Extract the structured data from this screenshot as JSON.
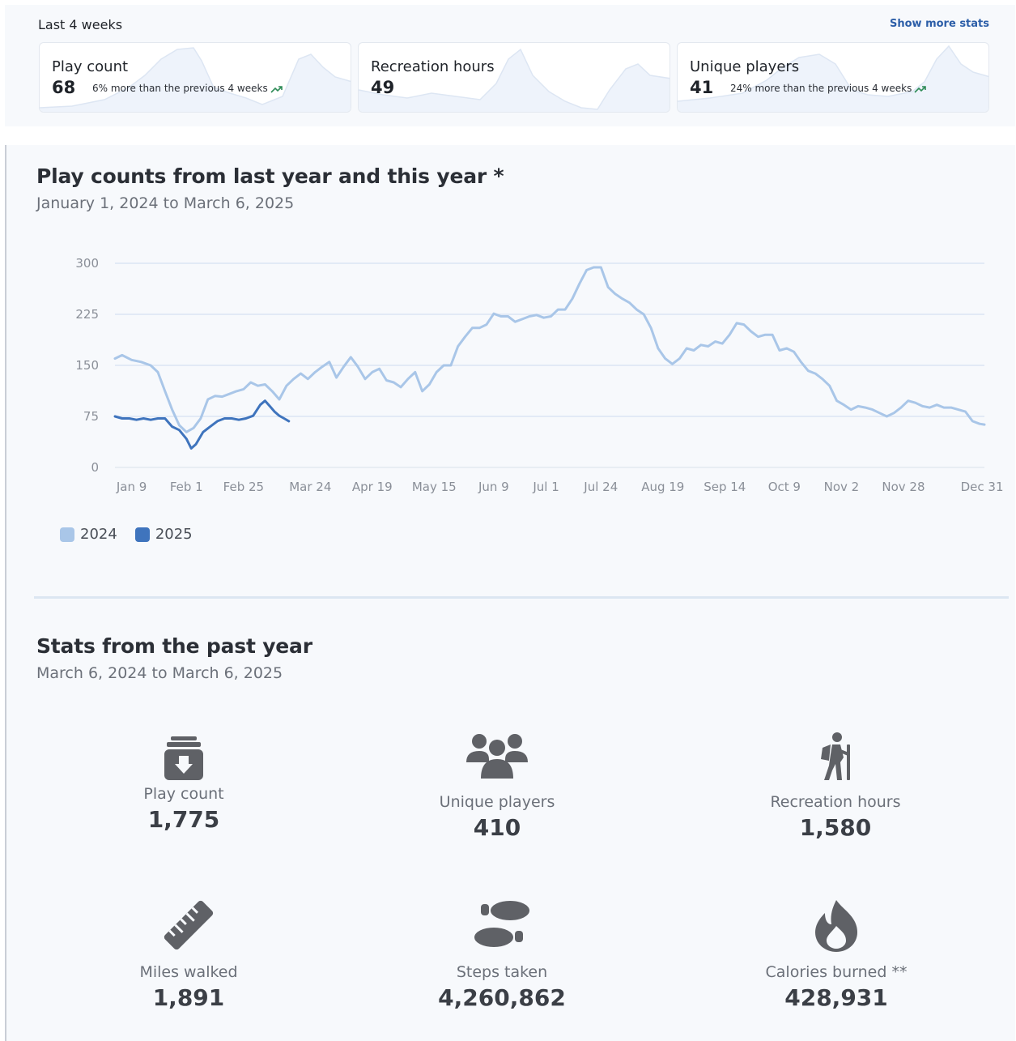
{
  "last4": {
    "title": "Last 4 weeks",
    "show_more": "Show more stats",
    "cards": [
      {
        "label": "Play count",
        "value": "68",
        "comparison": "6% more than the previous 4 weeks",
        "trend": "up"
      },
      {
        "label": "Recreation hours",
        "value": "49",
        "comparison": "",
        "trend": ""
      },
      {
        "label": "Unique players",
        "value": "41",
        "comparison": "24% more than the previous 4 weeks",
        "trend": "up"
      }
    ]
  },
  "chart_section": {
    "title": "Play counts from last year and this year *",
    "subtitle": "January 1, 2024 to March 6, 2025"
  },
  "chart_data": {
    "type": "line",
    "x_tick_labels": [
      "Jan 9",
      "Feb 1",
      "Feb 25",
      "Mar 24",
      "Apr 19",
      "May 15",
      "Jun 9",
      "Jul 1",
      "Jul 24",
      "Aug 19",
      "Sep 14",
      "Oct 9",
      "Nov 2",
      "Nov 28",
      "Dec 31"
    ],
    "x_tick_days": [
      8,
      31,
      55,
      83,
      109,
      135,
      160,
      182,
      205,
      231,
      257,
      282,
      306,
      332,
      365
    ],
    "yticks": [
      0,
      75,
      150,
      225,
      300
    ],
    "ylim": [
      0,
      300
    ],
    "xlim": [
      1,
      366
    ],
    "legend_position": "bottom-left",
    "grid": true,
    "series": [
      {
        "name": "2024",
        "color": "#a9c6e8",
        "points": [
          [
            1,
            160
          ],
          [
            4,
            165
          ],
          [
            8,
            158
          ],
          [
            12,
            155
          ],
          [
            16,
            150
          ],
          [
            19,
            140
          ],
          [
            22,
            112
          ],
          [
            25,
            85
          ],
          [
            28,
            62
          ],
          [
            31,
            52
          ],
          [
            34,
            58
          ],
          [
            37,
            72
          ],
          [
            40,
            100
          ],
          [
            43,
            105
          ],
          [
            46,
            104
          ],
          [
            49,
            108
          ],
          [
            52,
            112
          ],
          [
            55,
            115
          ],
          [
            58,
            125
          ],
          [
            61,
            120
          ],
          [
            64,
            122
          ],
          [
            67,
            112
          ],
          [
            70,
            100
          ],
          [
            73,
            120
          ],
          [
            76,
            130
          ],
          [
            79,
            138
          ],
          [
            82,
            130
          ],
          [
            85,
            140
          ],
          [
            88,
            148
          ],
          [
            91,
            155
          ],
          [
            94,
            132
          ],
          [
            97,
            148
          ],
          [
            100,
            162
          ],
          [
            103,
            148
          ],
          [
            106,
            130
          ],
          [
            109,
            140
          ],
          [
            112,
            145
          ],
          [
            115,
            128
          ],
          [
            118,
            125
          ],
          [
            121,
            118
          ],
          [
            124,
            130
          ],
          [
            127,
            140
          ],
          [
            130,
            112
          ],
          [
            133,
            122
          ],
          [
            136,
            140
          ],
          [
            139,
            150
          ],
          [
            142,
            150
          ],
          [
            145,
            178
          ],
          [
            148,
            192
          ],
          [
            151,
            205
          ],
          [
            154,
            205
          ],
          [
            157,
            210
          ],
          [
            160,
            226
          ],
          [
            163,
            222
          ],
          [
            166,
            222
          ],
          [
            169,
            214
          ],
          [
            172,
            218
          ],
          [
            175,
            222
          ],
          [
            178,
            224
          ],
          [
            181,
            220
          ],
          [
            184,
            222
          ],
          [
            187,
            232
          ],
          [
            190,
            232
          ],
          [
            193,
            248
          ],
          [
            196,
            270
          ],
          [
            199,
            290
          ],
          [
            202,
            294
          ],
          [
            205,
            294
          ],
          [
            208,
            265
          ],
          [
            211,
            255
          ],
          [
            214,
            248
          ],
          [
            217,
            242
          ],
          [
            220,
            232
          ],
          [
            223,
            225
          ],
          [
            226,
            205
          ],
          [
            229,
            175
          ],
          [
            232,
            160
          ],
          [
            235,
            152
          ],
          [
            238,
            160
          ],
          [
            241,
            175
          ],
          [
            244,
            172
          ],
          [
            247,
            180
          ],
          [
            250,
            178
          ],
          [
            253,
            185
          ],
          [
            256,
            182
          ],
          [
            259,
            195
          ],
          [
            262,
            212
          ],
          [
            265,
            210
          ],
          [
            268,
            200
          ],
          [
            271,
            192
          ],
          [
            274,
            195
          ],
          [
            277,
            195
          ],
          [
            280,
            172
          ],
          [
            283,
            175
          ],
          [
            286,
            170
          ],
          [
            289,
            155
          ],
          [
            292,
            142
          ],
          [
            295,
            138
          ],
          [
            298,
            130
          ],
          [
            301,
            120
          ],
          [
            304,
            98
          ],
          [
            307,
            92
          ],
          [
            310,
            85
          ],
          [
            313,
            90
          ],
          [
            316,
            88
          ],
          [
            319,
            85
          ],
          [
            322,
            80
          ],
          [
            325,
            75
          ],
          [
            328,
            80
          ],
          [
            331,
            88
          ],
          [
            334,
            98
          ],
          [
            337,
            95
          ],
          [
            340,
            90
          ],
          [
            343,
            88
          ],
          [
            346,
            92
          ],
          [
            349,
            88
          ],
          [
            352,
            88
          ],
          [
            355,
            85
          ],
          [
            358,
            82
          ],
          [
            361,
            68
          ],
          [
            364,
            64
          ],
          [
            366,
            63
          ]
        ]
      },
      {
        "name": "2025",
        "color": "#3f74bd",
        "points": [
          [
            1,
            75
          ],
          [
            4,
            72
          ],
          [
            7,
            72
          ],
          [
            10,
            70
          ],
          [
            13,
            72
          ],
          [
            16,
            70
          ],
          [
            19,
            72
          ],
          [
            22,
            72
          ],
          [
            25,
            60
          ],
          [
            28,
            55
          ],
          [
            31,
            42
          ],
          [
            33,
            28
          ],
          [
            35,
            34
          ],
          [
            38,
            52
          ],
          [
            41,
            60
          ],
          [
            44,
            68
          ],
          [
            47,
            72
          ],
          [
            50,
            72
          ],
          [
            53,
            70
          ],
          [
            56,
            72
          ],
          [
            59,
            76
          ],
          [
            62,
            92
          ],
          [
            64,
            98
          ],
          [
            66,
            90
          ],
          [
            68,
            82
          ],
          [
            70,
            76
          ],
          [
            72,
            72
          ],
          [
            74,
            68
          ]
        ]
      }
    ]
  },
  "year_section": {
    "title": "Stats from the past year",
    "subtitle": "March 6, 2024 to March 6, 2025",
    "stats": [
      {
        "label": "Play count",
        "value": "1,775",
        "icon": "disc-golf-basket-icon"
      },
      {
        "label": "Unique players",
        "value": "410",
        "icon": "group-icon"
      },
      {
        "label": "Recreation hours",
        "value": "1,580",
        "icon": "hiker-icon"
      },
      {
        "label": "Miles walked",
        "value": "1,891",
        "icon": "ruler-icon"
      },
      {
        "label": "Steps taken",
        "value": "4,260,862",
        "icon": "footprints-icon"
      },
      {
        "label": "Calories burned **",
        "value": "428,931",
        "icon": "flame-icon"
      }
    ]
  }
}
